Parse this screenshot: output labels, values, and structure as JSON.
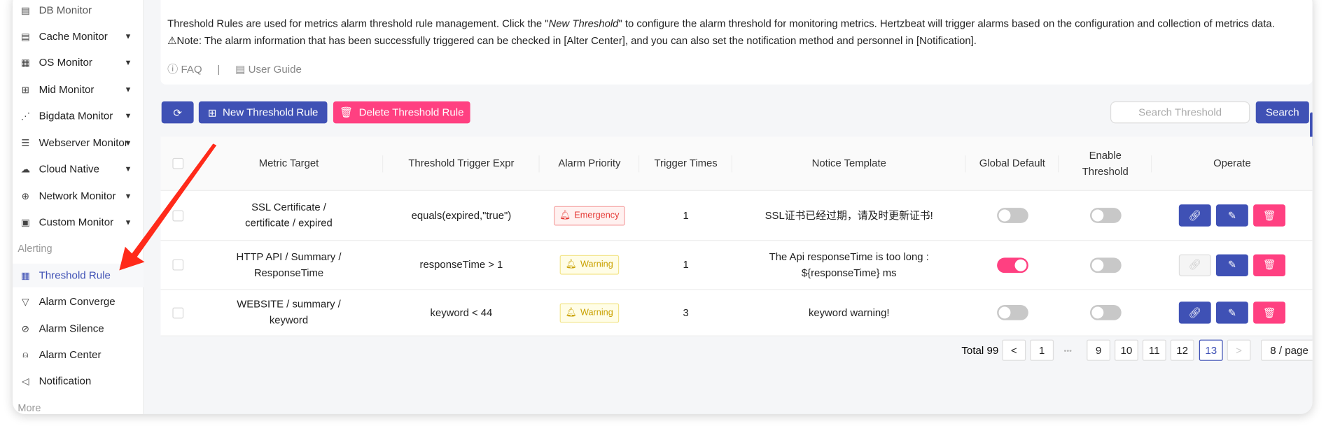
{
  "colors": {
    "primary": "#3f51b5",
    "danger": "#ff4081",
    "arrow": "#ff2a1a"
  },
  "sidebar": {
    "cut_item": "DB Monitor",
    "items": [
      {
        "label": "Cache Monitor",
        "icon": "database-icon"
      },
      {
        "label": "OS Monitor",
        "icon": "os-grid-icon"
      },
      {
        "label": "Mid Monitor",
        "icon": "cluster-icon"
      },
      {
        "label": "Bigdata Monitor",
        "icon": "dot-chart-icon"
      },
      {
        "label": "Webserver Monitor",
        "icon": "server-icon"
      },
      {
        "label": "Cloud Native",
        "icon": "cloud-icon"
      },
      {
        "label": "Network Monitor",
        "icon": "globe-icon"
      },
      {
        "label": "Custom Monitor",
        "icon": "project-icon"
      }
    ],
    "section_alerting": "Alerting",
    "alert_items": [
      {
        "label": "Threshold Rule",
        "icon": "calculator-icon",
        "active": true
      },
      {
        "label": "Alarm Converge",
        "icon": "filter-icon"
      },
      {
        "label": "Alarm Silence",
        "icon": "audio-muted-icon"
      },
      {
        "label": "Alarm Center",
        "icon": "alert-icon"
      },
      {
        "label": "Notification",
        "icon": "notification-icon"
      }
    ],
    "section_more": "More"
  },
  "intro": {
    "line1_a": "Threshold Rules are used for metrics alarm threshold rule management. Click the \"",
    "line1_em": "New Threshold",
    "line1_b": "\" to configure the alarm threshold for monitoring metrics. Hertzbeat will trigger alarms based on the configuration and collection of metrics data.",
    "line2": "⚠Note: The alarm information that has been successfully triggered can be checked in [Alter Center], and you can also set the notification method and personnel in [Notification].",
    "faq": "FAQ",
    "sep": "|",
    "guide": "User Guide"
  },
  "toolbar": {
    "new": "New Threshold Rule",
    "delete": "Delete Threshold Rule",
    "search_placeholder": "Search Threshold",
    "search": "Search"
  },
  "table": {
    "headers": [
      "Metric Target",
      "Threshold Trigger Expr",
      "Alarm Priority",
      "Trigger Times",
      "Notice Template",
      "Global Default",
      "Enable Threshold",
      "Operate"
    ],
    "rows": [
      {
        "target": "SSL Certificate / certificate / expired",
        "expr": "equals(expired,\"true\")",
        "priority": "Emergency",
        "times": "1",
        "template": "SSL证书已经过期，请及时更新证书!",
        "global": false,
        "enable": false,
        "link_enabled": true
      },
      {
        "target": "HTTP API / Summary / ResponseTime",
        "expr": "responseTime > 1",
        "priority": "Warning",
        "times": "1",
        "template": "The Api responseTime is too long : ${responseTime} ms",
        "global": true,
        "enable": false,
        "link_enabled": false
      },
      {
        "target": "WEBSITE / summary / keyword",
        "expr": "keyword < 44",
        "priority": "Warning",
        "times": "3",
        "template": "keyword warning!",
        "global": false,
        "enable": false,
        "link_enabled": true
      }
    ]
  },
  "pagination": {
    "total": "Total 99",
    "pages": [
      "1",
      "9",
      "10",
      "11",
      "12",
      "13"
    ],
    "current": "13",
    "ellipsis": "•••",
    "page_size": "8 / page"
  }
}
